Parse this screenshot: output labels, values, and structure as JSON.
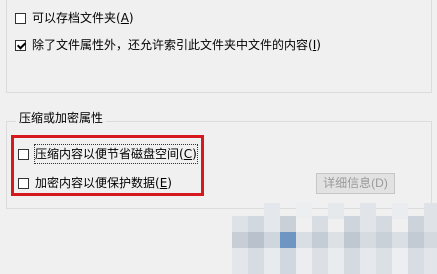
{
  "options": {
    "archive_label": "可以存档文件夹(",
    "archive_key": "A",
    "archive_tail": ")",
    "archive_checked": false,
    "index_label": "除了文件属性外，还允许索引此文件夹中文件的内容(",
    "index_key": "I",
    "index_tail": ")",
    "index_checked": true
  },
  "compress_group": {
    "title": "压缩或加密属性",
    "compress_label": "压缩内容以便节省磁盘空间(",
    "compress_key": "C",
    "compress_tail": ")",
    "compress_checked": false,
    "encrypt_label": "加密内容以便保护数据(",
    "encrypt_key": "E",
    "encrypt_tail": ")",
    "encrypt_checked": false,
    "details_button": "详细信息(D)"
  },
  "colors": {
    "highlight": "#d6191f",
    "background": "#f0f0f0"
  }
}
